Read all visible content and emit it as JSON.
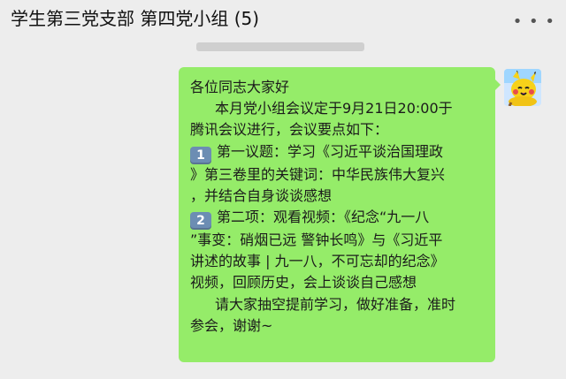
{
  "header": {
    "title": "学生第三党支部 第四党小组 (5)",
    "more_icon": "more-dots-icon"
  },
  "avatar": {
    "icon": "pikachu-avatar-icon"
  },
  "message": {
    "bubble_color": "#95ec69",
    "greeting": "各位同志大家好",
    "lines": [
      "本月党小组会议定于9月21日20:00于",
      "腾讯会议进行，会议要点如下：",
      "第一议题：学习《习近平谈治国理政",
      "》第三卷里的关键词：中华民族伟大复兴",
      "，并结合自身谈谈感想",
      "第二项：观看视频：《纪念“九一八",
      "”事变：硝烟已远 警钟长鸣》与《习近平",
      "讲述的故事 | 九一八，不可忘却的纪念》",
      "视频，回顾历史，会上谈谈自己感想",
      "请大家抽空提前学习，做好准备，准时",
      "参会，谢谢~"
    ],
    "keycap_1": "1",
    "keycap_2": "2"
  }
}
